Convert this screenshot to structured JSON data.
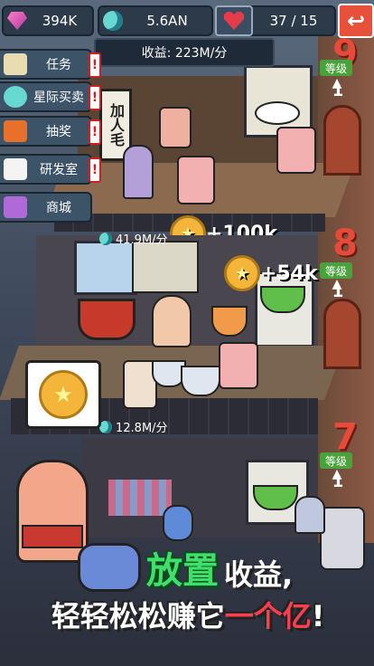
{
  "hud": {
    "gems": "394K",
    "moons": "5.6AN",
    "hearts": "37 / 15",
    "income": "收益: 223M/分",
    "exit_icon": "exit-arrow-icon"
  },
  "menu": [
    {
      "label": "任务",
      "icon": "task-scroll-icon",
      "alert": "!"
    },
    {
      "label": "星际买卖",
      "icon": "moon-trade-icon",
      "alert": "!"
    },
    {
      "label": "抽奖",
      "icon": "gift-box-icon",
      "alert": "!"
    },
    {
      "label": "研发室",
      "icon": "chef-hat-icon",
      "alert": "!"
    },
    {
      "label": "商城",
      "icon": "shop-icon",
      "alert": ""
    }
  ],
  "floors": [
    {
      "number": "9",
      "level_label": "等级",
      "level": "1",
      "rate": "",
      "bonus": "+100k"
    },
    {
      "number": "8",
      "level_label": "等级",
      "level": "1",
      "rate": "41.9M/分",
      "bonus": "+54k"
    },
    {
      "number": "7",
      "level_label": "等级",
      "level": "1",
      "rate": "12.8M/分",
      "bonus": ""
    }
  ],
  "signs": {
    "shop_sign": "加人毛"
  },
  "marketing": {
    "line1_green": "放置",
    "line1_white": "收益,",
    "line2_white": "轻轻松松赚它",
    "line2_red": "一个亿",
    "line2_end": "!"
  },
  "colors": {
    "accent_red": "#e84a3a",
    "accent_green": "#3fe06a",
    "hud_bg": "#2c3a4a"
  }
}
